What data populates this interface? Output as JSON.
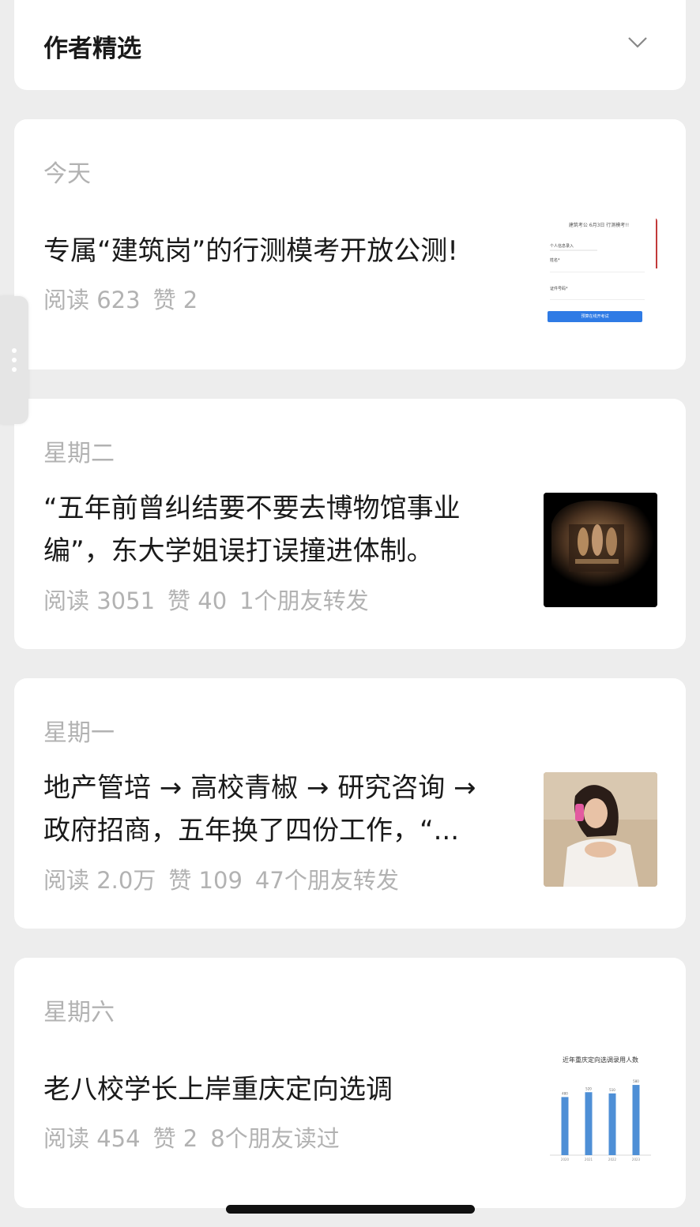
{
  "header": {
    "title": "作者精选"
  },
  "articles": [
    {
      "day": "今天",
      "title": "专属“建筑岗”的行测模考开放公测!",
      "reads": "阅读 623",
      "likes": "赞 2",
      "extra": "",
      "thumb": {
        "type": "form",
        "heading": "建筑考公 6月3日 行测模考!!",
        "field1": "个人信息录入",
        "field2": "姓名*",
        "field3": "证件号码*",
        "button": "预算在线开考试"
      }
    },
    {
      "day": "星期二",
      "title": "“五年前曾纠结要不要去博物馆事业\n编”，东大学姐误打误撞进体制。",
      "reads": "阅读 3051",
      "likes": "赞 40",
      "extra": "1个朋友转发",
      "thumb": {
        "type": "museum"
      }
    },
    {
      "day": "星期一",
      "title": "地产管培 → 高校青椒 → 研究咨询 →\n政府招商，五年换了四份工作，“...",
      "reads": "阅读 2.0万",
      "likes": "赞 109",
      "extra": "47个朋友转发",
      "thumb": {
        "type": "portrait"
      }
    },
    {
      "day": "星期六",
      "title": "老八校学长上岸重庆定向选调",
      "reads": "阅读 454",
      "likes": "赞 2",
      "extra": "8个朋友读过",
      "thumb": {
        "type": "chart",
        "chart_title": "近年重庆定向选调录用人数"
      }
    }
  ],
  "chart_data": {
    "type": "bar",
    "title": "近年重庆定向选调录用人数",
    "categories": [
      "2020",
      "2021",
      "2022",
      "2023"
    ],
    "values": [
      480,
      520,
      510,
      580
    ],
    "color": "#4e8fd6"
  },
  "colors": {
    "background": "#ededed",
    "card": "#ffffff",
    "muted": "#b2b2b2",
    "text": "#1a1a1a",
    "accent": "#2f7be5"
  }
}
